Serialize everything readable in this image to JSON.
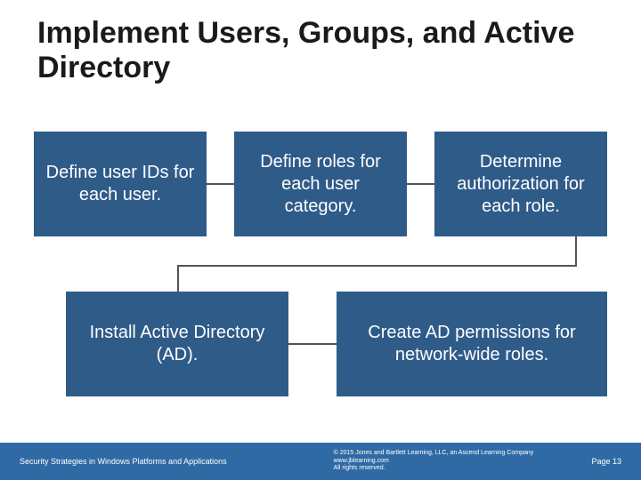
{
  "title": "Implement Users, Groups, and Active Directory",
  "boxes": {
    "b1": "Define user IDs for each user.",
    "b2": "Define roles for each user category.",
    "b3": "Determine authorization for each role.",
    "b4": "Install Active Directory (AD).",
    "b5": "Create AD permissions for network-wide roles."
  },
  "footer": {
    "left": "Security Strategies in Windows Platforms and Applications",
    "line1": "© 2015 Jones and Bartlett Learning, LLC, an Ascend Learning Company",
    "line2": "www.jblearning.com",
    "line3": "All rights reserved.",
    "page": "Page 13"
  },
  "colors": {
    "box_bg": "#2f5b89",
    "footer_bg": "#2f6aa5"
  }
}
